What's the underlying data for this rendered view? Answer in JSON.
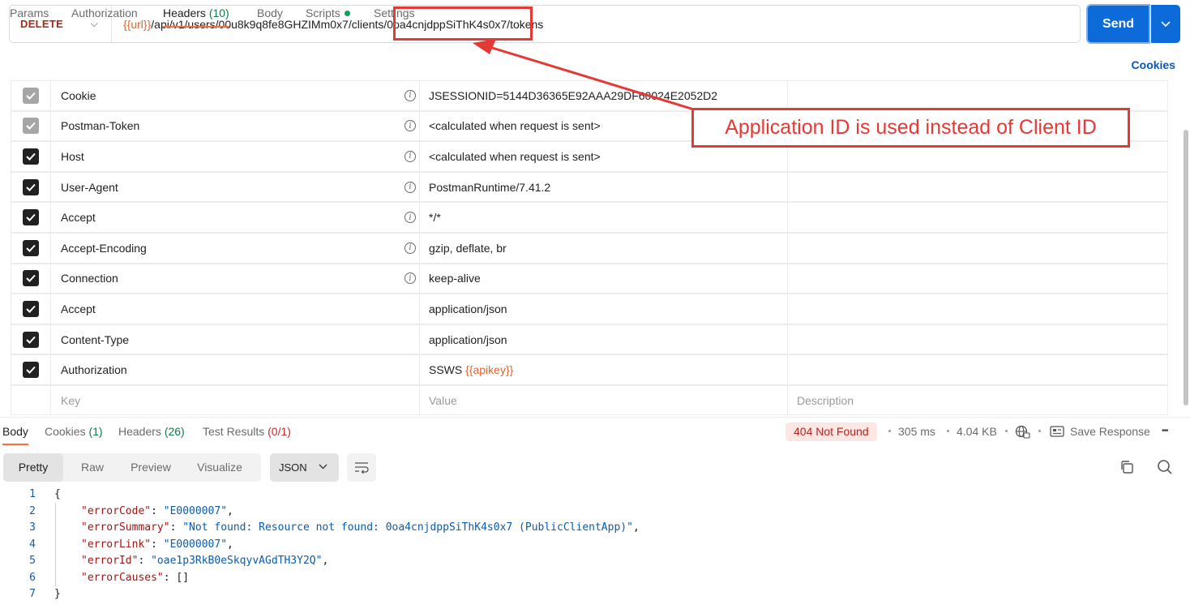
{
  "request": {
    "method": "DELETE",
    "url_var": "{{url}}",
    "url_rest": "/api/v1/users/00u8k9q8fe8GHZIMm0x7/clients/0oa4cnjdppSiThK4s0x7/tokens",
    "send_label": "Send"
  },
  "req_tabs": {
    "params": "Params",
    "authorization": "Authorization",
    "headers": "Headers",
    "headers_count": "(10)",
    "body": "Body",
    "scripts": "Scripts",
    "settings": "Settings",
    "cookies": "Cookies"
  },
  "headers": [
    {
      "key": "Cookie",
      "value": "JSESSIONID=5144D36365E92AAA29DF60024E2052D2",
      "checked": "disabled"
    },
    {
      "key": "Postman-Token",
      "value": "<calculated when request is sent>",
      "checked": "disabled"
    },
    {
      "key": "Host",
      "value": "<calculated when request is sent>",
      "checked": "true"
    },
    {
      "key": "User-Agent",
      "value": "PostmanRuntime/7.41.2",
      "checked": "true"
    },
    {
      "key": "Accept",
      "value": "*/*",
      "checked": "true"
    },
    {
      "key": "Accept-Encoding",
      "value": "gzip, deflate, br",
      "checked": "true"
    },
    {
      "key": "Connection",
      "value": "keep-alive",
      "checked": "true"
    },
    {
      "key": "Accept",
      "value": "application/json",
      "checked": "true"
    },
    {
      "key": "Content-Type",
      "value": "application/json",
      "checked": "true"
    },
    {
      "key": "Authorization",
      "value_prefix": "SSWS ",
      "value_var": "{{apikey}}",
      "checked": "true"
    }
  ],
  "header_placeholders": {
    "key": "Key",
    "value": "Value",
    "description": "Description"
  },
  "response": {
    "tab_body": "Body",
    "tab_cookies": "Cookies",
    "cookies_count": "(1)",
    "tab_headers": "Headers",
    "headers_count": "(26)",
    "tab_tests": "Test Results",
    "tests_count": "(0/1)",
    "status": "404 Not Found",
    "time": "305 ms",
    "size": "4.04 KB",
    "save": "Save Response",
    "more": "•••"
  },
  "view": {
    "pretty": "Pretty",
    "raw": "Raw",
    "preview": "Preview",
    "visualize": "Visualize",
    "format": "JSON"
  },
  "code_lines": [
    {
      "n": "1",
      "k": "",
      "v": "",
      "plain": "{"
    },
    {
      "n": "2",
      "k": "\"errorCode\"",
      "v": "\"E0000007\"",
      "plain": ""
    },
    {
      "n": "3",
      "k": "\"errorSummary\"",
      "v": "\"Not found: Resource not found: 0oa4cnjdppSiThK4s0x7 (PublicClientApp)\"",
      "plain": ""
    },
    {
      "n": "4",
      "k": "\"errorLink\"",
      "v": "\"E0000007\"",
      "plain": ""
    },
    {
      "n": "5",
      "k": "\"errorId\"",
      "v": "\"oae1p3RkB0eSkqyvAGdTH3Y2Q\"",
      "plain": ""
    },
    {
      "n": "6",
      "k": "\"errorCauses\"",
      "v": "[]",
      "plain": ""
    },
    {
      "n": "7",
      "k": "",
      "v": "",
      "plain": "}"
    }
  ],
  "annotation": {
    "text": "Application ID is used instead of Client ID",
    "color": "#e53935"
  }
}
